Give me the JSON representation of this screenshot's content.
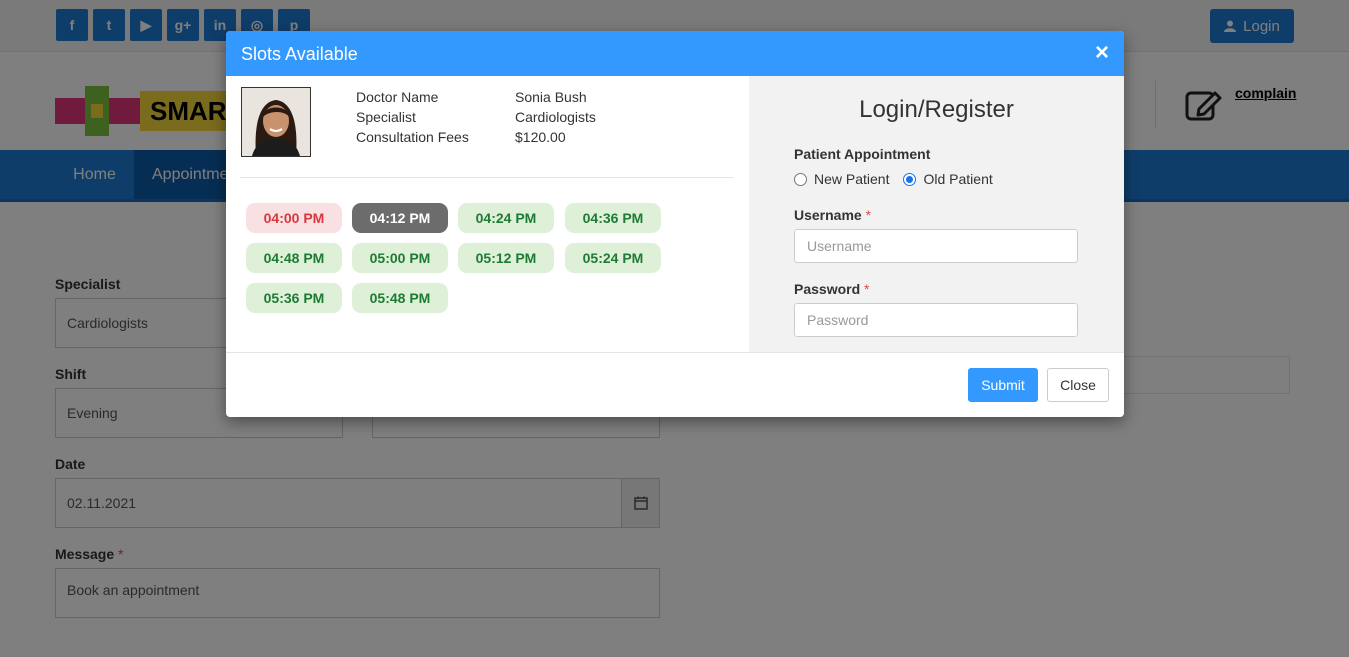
{
  "topbar": {
    "social_icons": [
      {
        "name": "facebook-icon",
        "glyph": "f"
      },
      {
        "name": "twitter-icon",
        "glyph": "t"
      },
      {
        "name": "youtube-icon",
        "glyph": "▶"
      },
      {
        "name": "google-plus-icon",
        "glyph": "g+"
      },
      {
        "name": "linkedin-icon",
        "glyph": "in"
      },
      {
        "name": "instagram-icon",
        "glyph": "◎"
      },
      {
        "name": "pinterest-icon",
        "glyph": "p"
      }
    ],
    "login_label": "Login"
  },
  "header": {
    "brand_text": "SMART",
    "complain_label": "complain"
  },
  "nav": {
    "home": "Home",
    "appointment": "Appointment"
  },
  "form": {
    "specialist_label": "Specialist",
    "specialist_value": "Cardiologists",
    "shift_label": "Shift",
    "shift_value": "Evening",
    "date_label": "Date",
    "date_value": "02.11.2021",
    "message_label": "Message",
    "message_value": "Book an appointment",
    "required_mark": "*"
  },
  "modal": {
    "title": "Slots Available",
    "close_glyph": "×",
    "doctor": {
      "name_label": "Doctor Name",
      "name_value": "Sonia Bush",
      "specialist_label": "Specialist",
      "specialist_value": "Cardiologists",
      "fees_label": "Consultation Fees",
      "fees_value": "$120.00"
    },
    "slots": [
      {
        "time": "04:00 PM",
        "state": "booked"
      },
      {
        "time": "04:12 PM",
        "state": "selected"
      },
      {
        "time": "04:24 PM",
        "state": "available"
      },
      {
        "time": "04:36 PM",
        "state": "available"
      },
      {
        "time": "04:48 PM",
        "state": "available"
      },
      {
        "time": "05:00 PM",
        "state": "available"
      },
      {
        "time": "05:12 PM",
        "state": "available"
      },
      {
        "time": "05:24 PM",
        "state": "available"
      },
      {
        "time": "05:36 PM",
        "state": "available"
      },
      {
        "time": "05:48 PM",
        "state": "available"
      }
    ],
    "login": {
      "title": "Login/Register",
      "patient_appointment_label": "Patient Appointment",
      "new_patient": "New Patient",
      "old_patient": "Old Patient",
      "selected_patient_type": "Old Patient",
      "username_label": "Username",
      "username_placeholder": "Username",
      "username_value": "",
      "password_label": "Password",
      "password_placeholder": "Password",
      "password_value": "",
      "required_mark": "*"
    },
    "submit_label": "Submit",
    "close_label": "Close"
  },
  "colors": {
    "brand_blue": "#1f7bd4",
    "modal_header": "#3399ff",
    "slot_available_bg": "#dff0d8",
    "slot_available_text": "#1e7b34",
    "slot_booked_bg": "#f9e0e2",
    "slot_booked_text": "#d9373e",
    "slot_selected_bg": "#6c6c6c"
  }
}
